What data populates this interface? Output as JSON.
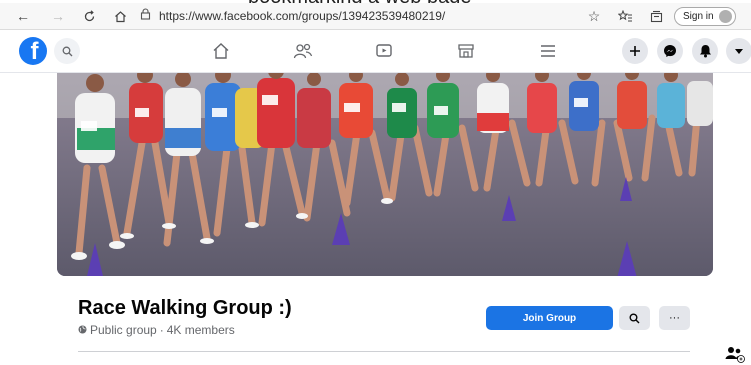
{
  "caption": {
    "text": "bookmarking a web page"
  },
  "browser": {
    "url": "https://www.facebook.com/groups/139423539480219/",
    "signin_label": "Sign in"
  },
  "fb_nav": {
    "logo_letter": "f",
    "tabs": [
      "home-icon",
      "people-icon",
      "video-icon",
      "marketplace-icon",
      "menu-icon"
    ],
    "actions": [
      "plus",
      "messenger",
      "notifications",
      "account-menu"
    ]
  },
  "group": {
    "title": "Race Walking Group :)",
    "privacy": "Public group",
    "separator": " · ",
    "members": "4K members",
    "join_label": "Join Group",
    "more_label": "···"
  },
  "colors": {
    "fb_blue": "#1877f2",
    "join_blue": "#1b74e4",
    "cover_track": "#7a7386",
    "cone_purple": "#5b3fb3"
  }
}
